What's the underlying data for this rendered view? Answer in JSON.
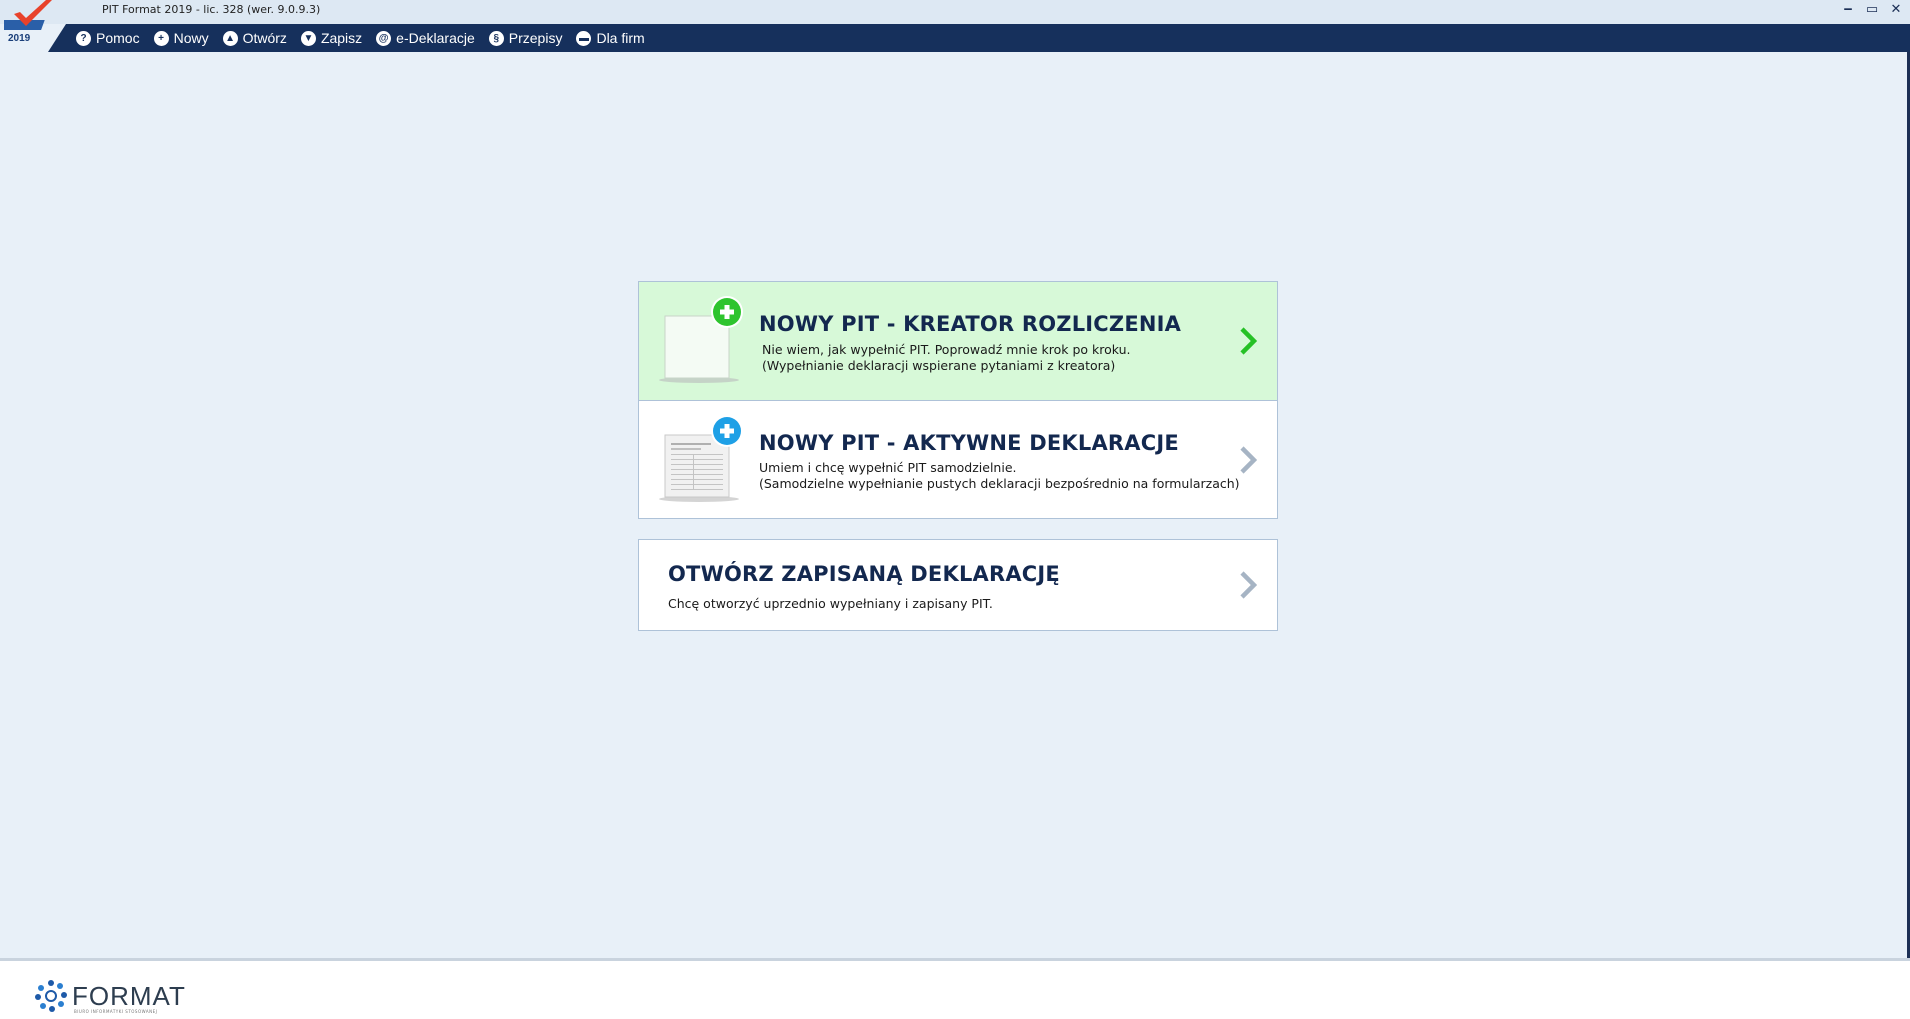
{
  "window": {
    "title": "PIT Format 2019 - lic. 328 (wer. 9.0.9.3)",
    "controls": [
      "‒",
      "▭",
      "✕"
    ]
  },
  "logo": {
    "year": "2019",
    "icon": "checkmark-logo-icon"
  },
  "menu": [
    {
      "label": "Pomoc",
      "icon": "?"
    },
    {
      "label": "Nowy",
      "icon": "+"
    },
    {
      "label": "Otwórz",
      "icon": "▲"
    },
    {
      "label": "Zapisz",
      "icon": "▼"
    },
    {
      "label": "e-Deklaracje",
      "icon": "@"
    },
    {
      "label": "Przepisy",
      "icon": "§"
    },
    {
      "label": "Dla firm",
      "icon": "▬"
    }
  ],
  "cards": {
    "wizard": {
      "title": "NOWY PIT - KREATOR ROZLICZENIA",
      "line1": "Nie wiem, jak wypełnić PIT. Poprowadź mnie krok po kroku.",
      "line2": "(Wypełnianie deklaracji wspierane pytaniami z kreatora)"
    },
    "active": {
      "title": "NOWY PIT - AKTYWNE DEKLARACJE",
      "line1": "Umiem i chcę wypełnić PIT samodzielnie.",
      "line2": "(Samodzielne wypełnianie pustych deklaracji bezpośrednio na formularzach)"
    },
    "open": {
      "title": "OTWÓRZ ZAPISANĄ DEKLARACJĘ",
      "line1": "Chcę otworzyć uprzednio wypełniany i zapisany PIT."
    }
  },
  "colors": {
    "menubar": "#16305c",
    "background": "#e8f0f8",
    "green_card": "#d7f9d8",
    "green_accent": "#2ec42e",
    "blue_accent": "#1ea0e6"
  },
  "footer": {
    "brand": "FORMAT",
    "tagline": "BIURO INFORMATYKI STOSOWANEJ"
  }
}
